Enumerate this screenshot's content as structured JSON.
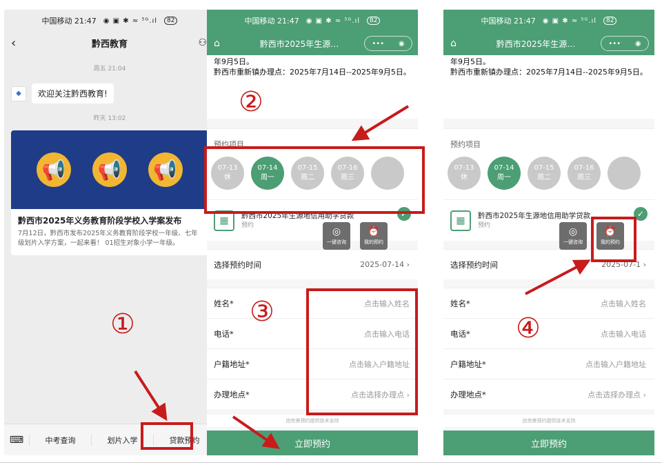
{
  "status_bar": {
    "carrier_time": "中国移动 21:47",
    "icons": "◉ ▣ ✱ ≈ ⁵ᴳ.ıl",
    "battery": "82"
  },
  "colors": {
    "accent": "#4c9e74",
    "annotation": "#c81b1b"
  },
  "phone1": {
    "title": "黔西教育",
    "time1": "周五 21:04",
    "welcome": "欢迎关注黔西教育!",
    "avatar_text": "◆",
    "time2": "昨天 13:02",
    "article_title": "黔西市2025年义务教育阶段学校入学案发布",
    "article_desc": "7月12日，黔西市发布2025年义务教育阶段学校一年级、七年级划片入学方案，一起来看！ 01招生对象小学一年级。",
    "bottom_menu": [
      "中考查询",
      "划片入学",
      "贷款预约"
    ]
  },
  "phone2": {
    "title": "黔西市2025年生源…",
    "top_text": "年9月5日。\n黔西市重新镇办理点：2025年7月14日--2025年9月5日。",
    "section_label": "预约项目",
    "dates": [
      {
        "d": "07-13",
        "w": "休"
      },
      {
        "d": "07-14",
        "w": "周一"
      },
      {
        "d": "07-15",
        "w": "周二"
      },
      {
        "d": "07-16",
        "w": "周三"
      }
    ],
    "service_name": "黔西市2025年生源地信用助学贷款",
    "service_sub": "预约",
    "float_btn1": "一键咨询",
    "float_btn2": "我的预约",
    "time_label": "选择预约时间",
    "time_value": "2025-07-14",
    "fields": [
      {
        "label": "姓名*",
        "placeholder": "点击输入姓名"
      },
      {
        "label": "电话*",
        "placeholder": "点击输入电话"
      },
      {
        "label": "户籍地址*",
        "placeholder": "点击输入户籍地址"
      },
      {
        "label": "办理地点*",
        "placeholder": "点击选择办理点"
      }
    ],
    "powered": "由完美预约提供技术支持",
    "submit": "立即预约"
  },
  "phone3": {
    "title": "黔西市2025年生源…",
    "top_text": "年9月5日。\n黔西市重新镇办理点：2025年7月14日--2025年9月5日。",
    "section_label": "预约项目",
    "dates": [
      {
        "d": "07-13",
        "w": "休"
      },
      {
        "d": "07-14",
        "w": "周一"
      },
      {
        "d": "07-15",
        "w": "周二"
      },
      {
        "d": "07-16",
        "w": "周三"
      }
    ],
    "service_name": "黔西市2025年生源地信用助学贷款",
    "service_sub": "预约",
    "float_btn1": "一键咨询",
    "float_btn2": "我的预约",
    "time_label": "选择预约时间",
    "time_value": "2025-07-1",
    "fields": [
      {
        "label": "姓名*",
        "placeholder": "点击输入姓名"
      },
      {
        "label": "电话*",
        "placeholder": "点击输入电话"
      },
      {
        "label": "户籍地址*",
        "placeholder": "点击输入户籍地址"
      },
      {
        "label": "办理地点*",
        "placeholder": "点击选择办理点"
      }
    ],
    "powered": "由完美预约提供技术支持",
    "submit": "立即预约"
  },
  "annotations": [
    "①",
    "②",
    "③",
    "④"
  ]
}
